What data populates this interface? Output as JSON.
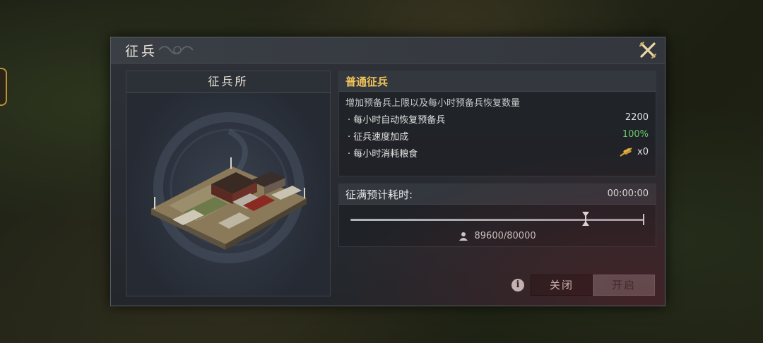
{
  "dialog": {
    "title": "征兵",
    "close_icon": "close-x-icon"
  },
  "building": {
    "name": "征兵所"
  },
  "recruit": {
    "section_title": "普通征兵",
    "description": "增加预备兵上限以及每小时预备兵恢复数量",
    "stats": [
      {
        "label": "· 每小时自动恢复预备兵",
        "value": "2200"
      },
      {
        "label": "· 征兵速度加成",
        "value": "100%"
      },
      {
        "label": "· 每小时消耗粮食",
        "value": "x0"
      }
    ]
  },
  "fill": {
    "label": "征满预计耗时:",
    "time": "00:00:00",
    "troops": "89600/80000",
    "slider_fraction": 0.8
  },
  "buttons": {
    "close": "关闭",
    "open": "开启"
  },
  "colors": {
    "accent_gold": "#f0c45a",
    "bonus_green": "#6cc96c"
  }
}
